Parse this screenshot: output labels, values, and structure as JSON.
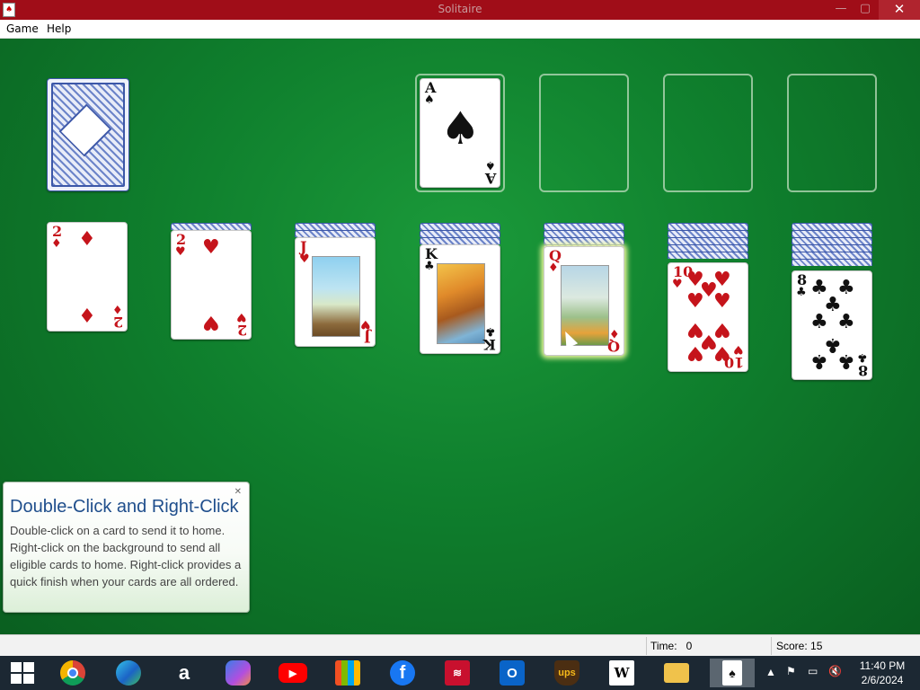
{
  "window": {
    "title": "Solitaire",
    "app_icon": "solitaire-card-icon",
    "controls": [
      "minimize",
      "maximize",
      "close"
    ],
    "close_symbol": "✕",
    "minimize_symbol": "—",
    "maximize_symbol": "▢"
  },
  "menu": [
    {
      "label": "Game"
    },
    {
      "label": "Help"
    }
  ],
  "table": {
    "felt_color": "#117f2e",
    "stock": {
      "cards_face_down": true
    },
    "foundations": [
      {
        "top": {
          "rank": "A",
          "suit": "♠",
          "color": "black"
        }
      },
      {
        "top": null
      },
      {
        "top": null
      },
      {
        "top": null
      }
    ],
    "tableau": [
      {
        "hidden": 0,
        "top": {
          "rank": "2",
          "suit": "♦",
          "color": "red"
        }
      },
      {
        "hidden": 1,
        "top": {
          "rank": "2",
          "suit": "♥",
          "color": "red"
        }
      },
      {
        "hidden": 2,
        "top": {
          "rank": "J",
          "suit": "♥",
          "color": "red"
        }
      },
      {
        "hidden": 3,
        "top": {
          "rank": "K",
          "suit": "♣",
          "color": "black"
        }
      },
      {
        "hidden": 4,
        "top": {
          "rank": "Q",
          "suit": "♦",
          "color": "red",
          "highlighted": true
        }
      },
      {
        "hidden": 5,
        "top": {
          "rank": "10",
          "suit": "♥",
          "color": "red"
        }
      },
      {
        "hidden": 6,
        "top": {
          "rank": "8",
          "suit": "♣",
          "color": "black"
        }
      }
    ]
  },
  "tip": {
    "title": "Double-Click and Right-Click",
    "body": "Double-click on a card to send it to home. Right-click on the background to send all eligible cards to home. Right-click provides a quick finish when your cards are all ordered.",
    "close_symbol": "✕"
  },
  "status": {
    "time_label": "Time:",
    "time_value": "0",
    "score_label": "Score:",
    "score_value": "15"
  },
  "taskbar": {
    "apps": [
      {
        "name": "start-icon"
      },
      {
        "name": "chrome-icon"
      },
      {
        "name": "edge-icon"
      },
      {
        "name": "amazon-icon"
      },
      {
        "name": "copilot-icon"
      },
      {
        "name": "youtube-icon"
      },
      {
        "name": "store-icon"
      },
      {
        "name": "facebook-icon"
      },
      {
        "name": "bank-of-america-icon"
      },
      {
        "name": "outlook-icon"
      },
      {
        "name": "ups-icon"
      },
      {
        "name": "wikipedia-icon"
      },
      {
        "name": "file-explorer-icon"
      },
      {
        "name": "solitaire-taskbar-icon",
        "active": true
      }
    ],
    "tray_icons": [
      "chevron-up-icon",
      "flag-icon",
      "network-icon",
      "volume-muted-icon"
    ],
    "clock": {
      "time": "11:40 PM",
      "date": "2/6/2024"
    }
  }
}
